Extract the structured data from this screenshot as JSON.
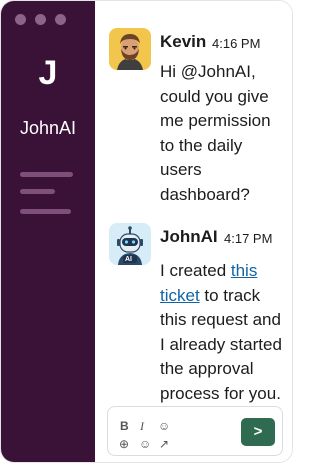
{
  "sidebar": {
    "workspace_initial": "J",
    "workspace_name": "JohnAI"
  },
  "messages": [
    {
      "author": "Kevin",
      "time": "4:16 PM",
      "avatar": "kevin-avatar",
      "lines": [
        "Hi @JohnAI,",
        "could you give",
        "me permission",
        "to the daily",
        "users",
        "dashboard?"
      ]
    },
    {
      "author": "JohnAI",
      "time": "4:17 PM",
      "avatar": "robot-avatar",
      "avatar_label": "AI",
      "line1_prefix": "I created ",
      "link_text_1": "this",
      "link_text_2": "ticket",
      "line2_suffix": " to track",
      "lines_after": [
        "this request and",
        "I already started",
        "the approval",
        "process for you."
      ]
    }
  ],
  "composer": {
    "bold_icon": "B",
    "italic_icon": "I",
    "emoji_icon": "☺",
    "add_icon": "⊕",
    "emoji2_icon": "☺",
    "arrow_icon": "↗",
    "send_label": ">"
  },
  "colors": {
    "sidebar_bg": "#3a1238",
    "accent_link": "#1264a3",
    "send_button": "#2e6b50"
  }
}
